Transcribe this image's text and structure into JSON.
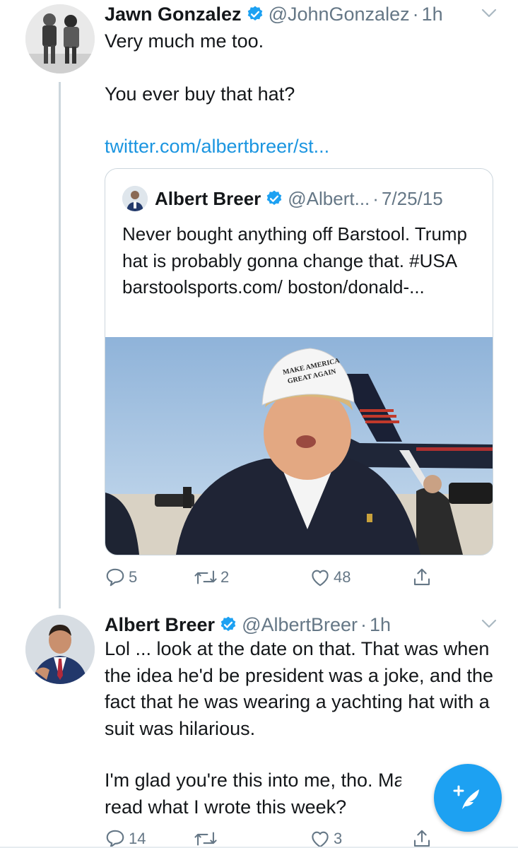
{
  "tweets": [
    {
      "display_name": "Jawn Gonzalez",
      "handle": "@JohnGonzalez",
      "separator": "·",
      "time": "1h",
      "text_line1": "Very much me too.",
      "text_line2": "You ever buy that hat?",
      "link": "twitter.com/albertbreer/st...",
      "avatar_icon": "avatar-two-men-photo",
      "quoted": {
        "display_name": "Albert Breer",
        "handle": "@Albert...",
        "separator": "·",
        "date": "7/25/15",
        "text": "Never bought anything off Barstool. Trump hat is probably gonna change that. #USA barstoolsports.com/ boston/donald-...",
        "image_icon": "photo-man-in-white-cap-by-jet",
        "hat_text_line1": "MAKE AMERICA",
        "hat_text_line2": "GREAT AGAIN"
      },
      "actions": {
        "replies": "5",
        "retweets": "2",
        "likes": "48"
      }
    },
    {
      "display_name": "Albert Breer",
      "handle": "@AlbertBreer",
      "separator": "·",
      "time": "1h",
      "text_para1": "Lol ... look at the date on that. That was when the idea he'd be president was a joke, and the fact that he was wearing a yachting hat with a suit was hilarious.",
      "text_para2_line1": "I'm glad you're this into me, tho. Maybe",
      "text_para2_line2": "read what I wrote this week?",
      "avatar_icon": "avatar-man-in-suit-photo",
      "actions": {
        "replies": "14",
        "retweets": "",
        "likes": "3"
      }
    }
  ],
  "colors": {
    "accent": "#1da1f2",
    "link": "#1b95e0",
    "secondary_text": "#657786",
    "border": "#ccd6dd"
  },
  "icons": [
    "verified-badge-icon",
    "chevron-down-icon",
    "reply-icon",
    "retweet-icon",
    "like-icon",
    "share-icon",
    "compose-tweet-icon"
  ]
}
